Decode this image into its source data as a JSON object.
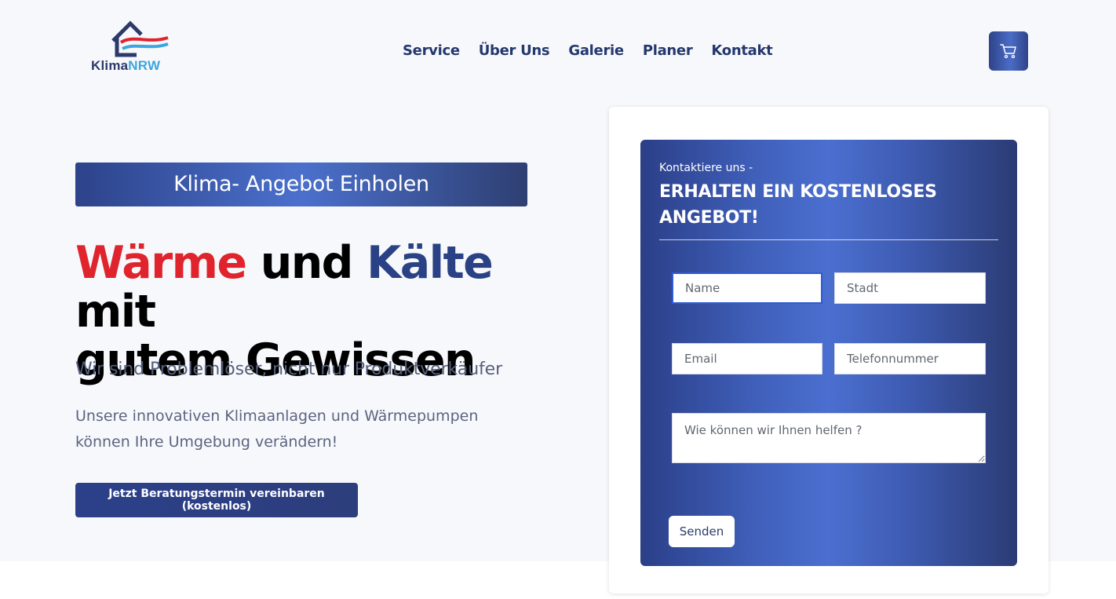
{
  "logo": {
    "part1": "Klima",
    "part2": "NRW"
  },
  "nav": {
    "items": [
      "Service",
      "Über Uns",
      "Galerie",
      "Planer",
      "Kontakt"
    ]
  },
  "icons": {
    "cart": "cart-icon",
    "logo_house": "house-logo-icon"
  },
  "colors": {
    "primary": "#2a4285",
    "accent_red": "#e0242d",
    "accent_light": "#4b70cc"
  },
  "hero": {
    "banner": "Klima- Angebot Einholen",
    "headline_word1": "Wärme",
    "headline_word2": "und",
    "headline_word3": "Kälte",
    "headline_rest1": "mit",
    "headline_rest2": "gutem Gewissen",
    "subline": "Wir sind Problemlöser, nicht nur Produktverkäufer",
    "description_line1": "Unsere innovativen Klimaanlagen und Wärmepumpen",
    "description_line2": "können Ihre Umgebung verändern!",
    "cta": "Jetzt Beratungstermin vereinbaren (kostenlos)"
  },
  "form": {
    "kicker": "Kontaktiere uns -",
    "title": "ERHALTEN EIN KOSTENLOSES ANGEBOT!",
    "name_placeholder": "Name",
    "city_placeholder": "Stadt",
    "email_placeholder": "Email",
    "phone_placeholder": "Telefonnummer",
    "message_placeholder": "Wie können wir Ihnen helfen ?",
    "submit": "Senden"
  }
}
